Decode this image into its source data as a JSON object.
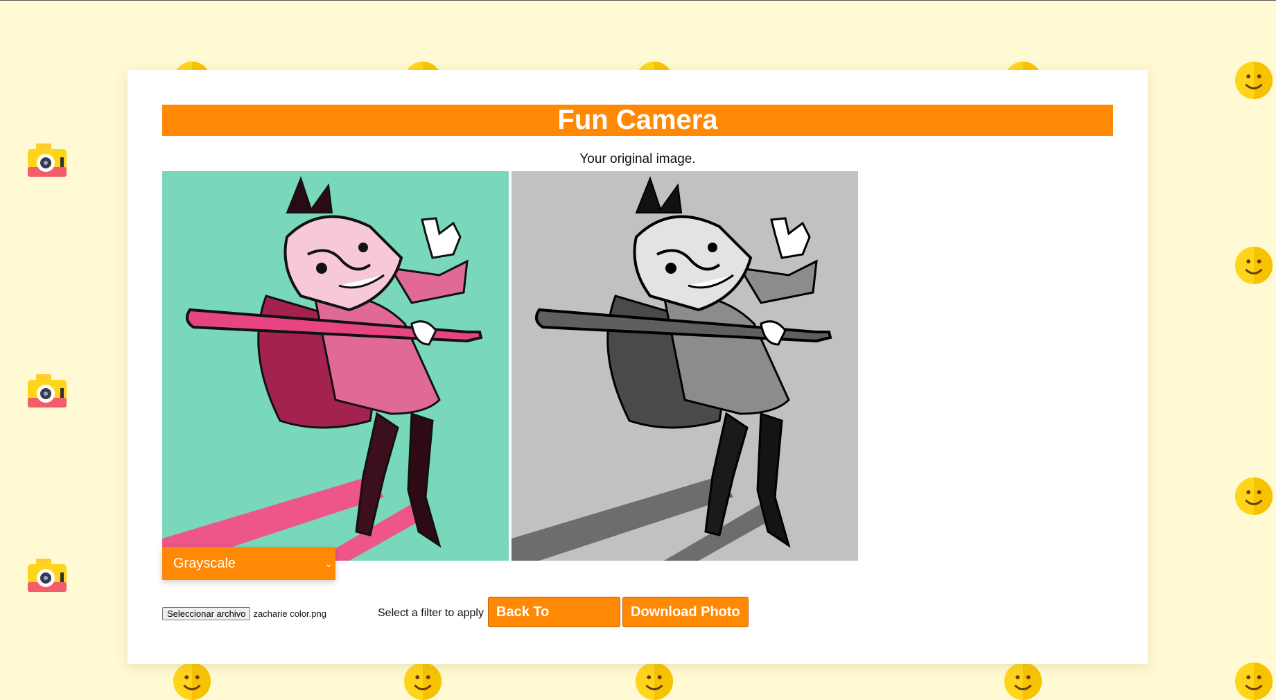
{
  "header": {
    "title": "Fun Camera"
  },
  "main": {
    "caption": "Your original image.",
    "original_image": {
      "alt": "original colour illustration"
    },
    "filtered_image": {
      "alt": "grayscale filtered illustration"
    }
  },
  "controls": {
    "filter_select": {
      "selected": "Grayscale",
      "options": [
        "Grayscale"
      ]
    },
    "file_input": {
      "button_label": "Seleccionar archivo",
      "file_name": "zacharie color.png"
    },
    "filter_hint": "Select a filter to apply",
    "back_button": "Back To WebCam",
    "download_button": "Download Photo"
  },
  "colors": {
    "accent": "#ff8805",
    "background": "#fff9d4",
    "original_bg": "#79d8bb",
    "gray_bg": "#c1c1c1"
  },
  "decor": {
    "icons": [
      "smiley-icon",
      "camera-icon"
    ]
  }
}
